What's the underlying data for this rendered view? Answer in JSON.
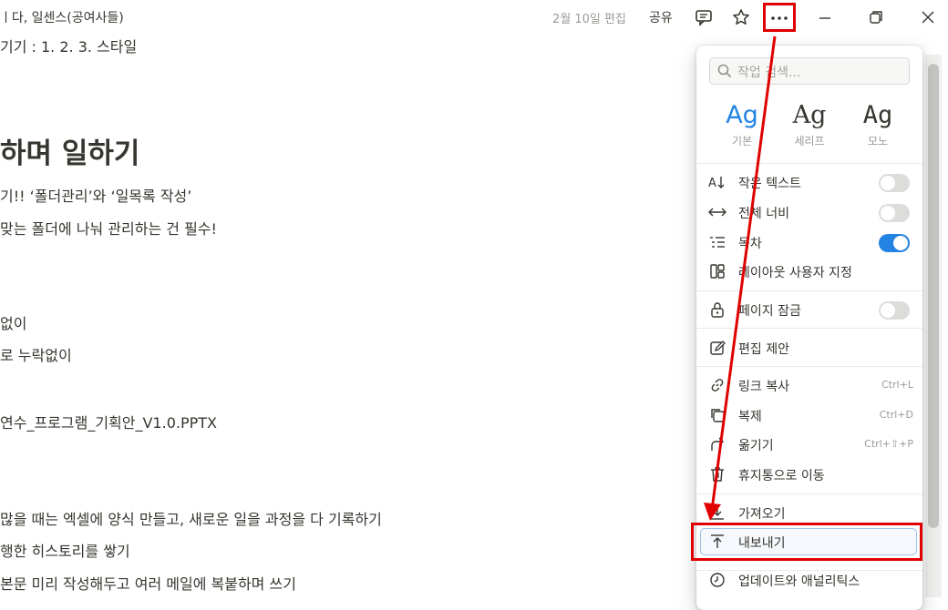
{
  "topbar": {
    "breadcrumb": "ㅣ다, 일센스(공여사들)",
    "edited": "2월 10일 편집",
    "share": "공유",
    "icons": [
      "comment-icon",
      "star-icon",
      "more-icon",
      "minimize-icon",
      "restore-icon",
      "close-icon"
    ]
  },
  "document": {
    "lines": [
      "기기 : 1. 2. 3. 스타일",
      "기!! ‘폴더관리’와 ‘일목록 작성’",
      "맞는 폴더에 나눠 관리하는 건 필수!",
      "없이",
      "로 누락없이",
      "연수_프로그램_기획안_V1.0.PPTX",
      "많을 때는 엑셀에 양식 만들고, 새로운 일을 과정을 다 기록하기",
      "행한 히스토리를 쌓기",
      "본문 미리 작성해두고 여러 메일에 복붙하며 쓰기"
    ],
    "heading": "하며 일하기"
  },
  "menu": {
    "search_placeholder": "작업 검색...",
    "fonts": [
      {
        "sample": "Ag",
        "label": "기본"
      },
      {
        "sample": "Ag",
        "label": "세리프"
      },
      {
        "sample": "Ag",
        "label": "모노"
      }
    ],
    "items": {
      "small_text": "작은 텍스트",
      "full_width": "전체 너비",
      "toc": "목차",
      "layout": "레이아웃 사용자 지정",
      "lock": "페이지 잠금",
      "suggest": "편집 제안",
      "copy_link": "링크 복사",
      "copy_link_sc": "Ctrl+L",
      "duplicate": "복제",
      "duplicate_sc": "Ctrl+D",
      "move": "옮기기",
      "move_sc": "Ctrl+⇧+P",
      "trash": "휴지통으로 이동",
      "import": "가져오기",
      "export": "내보내기",
      "updates": "업데이트와 애널리틱스"
    },
    "toggles": {
      "small_text": false,
      "full_width": false,
      "toc": true,
      "lock": false
    }
  },
  "colors": {
    "accent": "#2383e2",
    "highlight": "#e00000"
  }
}
